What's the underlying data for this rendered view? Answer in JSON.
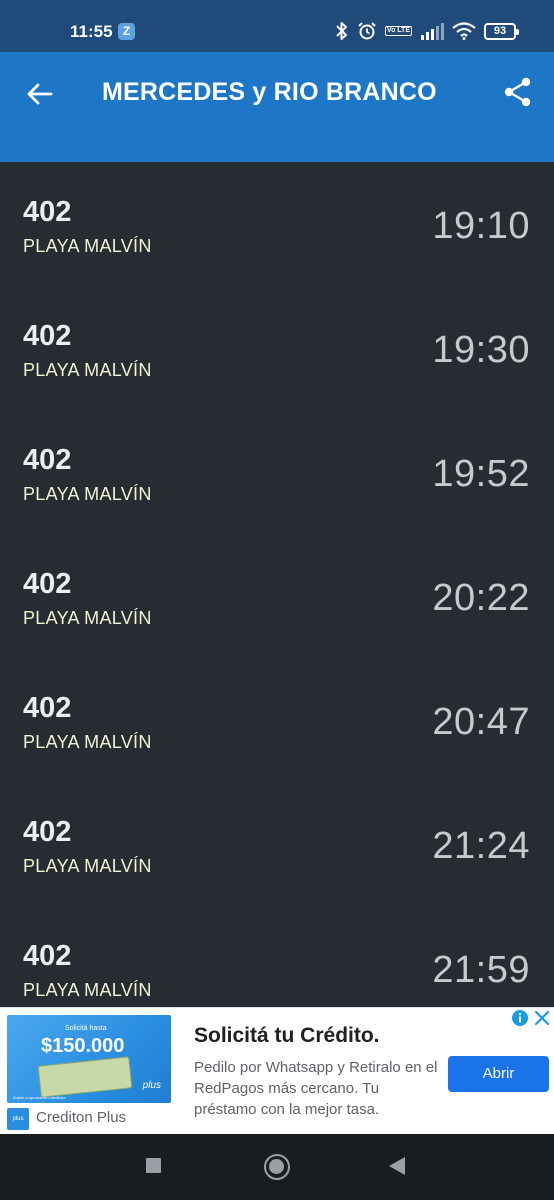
{
  "status_bar": {
    "time": "11:55",
    "notification_badge": "Z",
    "volte": "Vo LTE",
    "battery": "93"
  },
  "header": {
    "title": "MERCEDES y RIO BRANCO",
    "back_icon": "arrow-left-icon",
    "share_icon": "share-icon"
  },
  "arrivals": [
    {
      "route": "402",
      "destination": "PLAYA MALVÍN",
      "time": "19:10"
    },
    {
      "route": "402",
      "destination": "PLAYA MALVÍN",
      "time": "19:30"
    },
    {
      "route": "402",
      "destination": "PLAYA MALVÍN",
      "time": "19:52"
    },
    {
      "route": "402",
      "destination": "PLAYA MALVÍN",
      "time": "20:22"
    },
    {
      "route": "402",
      "destination": "PLAYA MALVÍN",
      "time": "20:47"
    },
    {
      "route": "402",
      "destination": "PLAYA MALVÍN",
      "time": "21:24"
    },
    {
      "route": "402",
      "destination": "PLAYA MALVÍN",
      "time": "21:59"
    }
  ],
  "ad": {
    "image_top": "Solicitá hasta",
    "image_amount": "$150.000",
    "image_brand": "plus",
    "image_fine_print": "Sujeto a aprobación crediticia.",
    "logo_text": "plus",
    "headline": "Solicitá tu Crédito.",
    "body": "Pedilo por Whatsapp y Retiralo en el RedPagos más cercano. Tu préstamo con la mejor tasa.",
    "advertiser": "Crediton Plus",
    "cta": "Abrir"
  },
  "colors": {
    "status_bar": "#1f4a7a",
    "app_bar": "#1e76c6",
    "list_background": "#262c31",
    "route_text": "#eceff1",
    "destination_text": "#f1f3d2",
    "time_text": "#c7cacd",
    "cta": "#1a73e8"
  }
}
